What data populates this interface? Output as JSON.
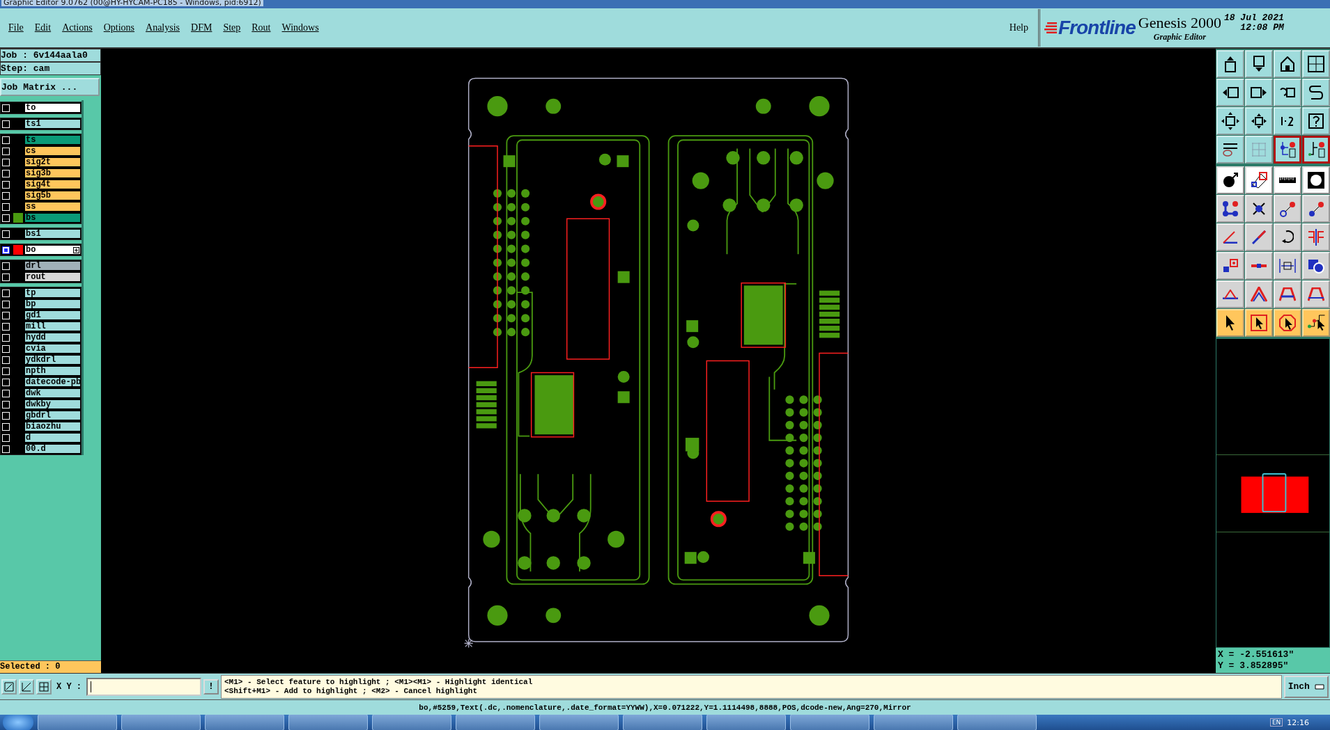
{
  "window": {
    "title": "Graphic Editor 9.0762 (00@HY-HYCAM-PC185 - Windows, pid:6912)"
  },
  "menu": [
    "File",
    "Edit",
    "Actions",
    "Options",
    "Analysis",
    "DFM",
    "Step",
    "Rout",
    "Windows"
  ],
  "help": "Help",
  "brand": {
    "logo": "Frontline",
    "product": "Genesis 2000",
    "subtitle": "Graphic Editor",
    "date": "18 Jul 2021",
    "time": "12:08 PM"
  },
  "job": {
    "job": "Job : 6v144aala0",
    "step": "Step: cam",
    "matrix_button": "Job Matrix ..."
  },
  "layer_groups": [
    {
      "layers": [
        {
          "name": "to",
          "color": "#ffffff",
          "selected": false
        }
      ]
    },
    {
      "layers": [
        {
          "name": "ts1",
          "color": "#9fdcdc",
          "selected": false
        }
      ]
    },
    {
      "layers": [
        {
          "name": "ts",
          "color": "#0a9a78",
          "selected": false
        },
        {
          "name": "cs",
          "color": "#ffc65c",
          "selected": false
        },
        {
          "name": "sig2t",
          "color": "#ffc65c",
          "selected": false
        },
        {
          "name": "sig3b",
          "color": "#ffc65c",
          "selected": false
        },
        {
          "name": "sig4t",
          "color": "#ffc65c",
          "selected": false
        },
        {
          "name": "sig5b",
          "color": "#ffc65c",
          "selected": false
        },
        {
          "name": "ss",
          "color": "#ffc65c",
          "selected": false
        },
        {
          "name": "bs",
          "color": "#0a9a78",
          "swatch": {
            "color": "#4a9a10"
          },
          "selected": false
        }
      ]
    },
    {
      "layers": [
        {
          "name": "bs1",
          "color": "#9fdcdc",
          "selected": false
        }
      ]
    },
    {
      "layers": [
        {
          "name": "bo",
          "color": "#ffffff",
          "swatch": {
            "color": "#ff0000"
          },
          "selected": true
        }
      ]
    },
    {
      "layers": [
        {
          "name": "drl",
          "color": "#a0b0b8",
          "selected": false
        },
        {
          "name": "rout",
          "color": "#d8d8d8",
          "selected": false
        }
      ]
    },
    {
      "layers": [
        {
          "name": "tp",
          "color": "#9fdcdc",
          "selected": false
        },
        {
          "name": "bp",
          "color": "#9fdcdc",
          "selected": false
        },
        {
          "name": "gd1",
          "color": "#9fdcdc",
          "selected": false
        },
        {
          "name": "mill",
          "color": "#9fdcdc",
          "selected": false
        },
        {
          "name": "hydd",
          "color": "#9fdcdc",
          "selected": false
        },
        {
          "name": "cvia",
          "color": "#9fdcdc",
          "selected": false
        },
        {
          "name": "ydkdrl",
          "color": "#9fdcdc",
          "selected": false
        },
        {
          "name": "npth",
          "color": "#9fdcdc",
          "selected": false
        },
        {
          "name": "datecode-pb",
          "color": "#9fdcdc",
          "selected": false
        },
        {
          "name": "dwk",
          "color": "#9fdcdc",
          "selected": false
        },
        {
          "name": "dwkby",
          "color": "#9fdcdc",
          "selected": false
        },
        {
          "name": "gbdrl",
          "color": "#9fdcdc",
          "selected": false
        },
        {
          "name": "biaozhu",
          "color": "#9fdcdc",
          "selected": false
        },
        {
          "name": "d",
          "color": "#9fdcdc",
          "selected": false
        },
        {
          "name": "00.d",
          "color": "#9fdcdc",
          "selected": false
        }
      ]
    }
  ],
  "selected_count": "Selected : 0",
  "tool_groups": [
    {
      "kind": "view",
      "buttons": [
        {
          "on": false
        },
        {
          "on": false
        },
        {
          "on": false
        },
        {
          "on": false
        },
        {
          "on": false
        },
        {
          "on": false
        },
        {
          "on": false
        },
        {
          "on": false
        },
        {
          "on": false
        },
        {
          "on": false
        },
        {
          "on": false
        },
        {
          "on": false
        },
        {
          "on": false
        },
        {
          "on": false
        },
        {
          "on": true
        },
        {
          "on": true
        }
      ]
    },
    {
      "kind": "edit",
      "buttons": [
        {
          "on": false
        },
        {
          "on": false
        },
        {
          "on": false
        },
        {
          "on": false
        },
        {
          "on": false
        },
        {
          "on": false
        },
        {
          "on": false
        },
        {
          "on": false
        },
        {
          "on": false
        },
        {
          "on": false
        },
        {
          "on": false
        },
        {
          "on": false
        },
        {
          "on": false
        },
        {
          "on": false
        },
        {
          "on": false
        },
        {
          "on": false
        },
        {
          "on": false
        },
        {
          "on": false
        },
        {
          "on": false
        },
        {
          "on": false
        },
        {
          "on": false
        },
        {
          "on": false
        },
        {
          "on": false
        },
        {
          "on": false
        }
      ]
    }
  ],
  "coordinates": {
    "x": "X = -2.551613\"",
    "y": "Y = 3.852895\""
  },
  "command_bar": {
    "xy_label": "X Y :",
    "bang": "!",
    "hints": [
      "<M1> - Select feature to highlight ; <M1><M1> - Highlight identical",
      "<Shift+M1> - Add to highlight ; <M2> - Cancel highlight"
    ],
    "units": "Inch"
  },
  "status_line": "bo,#5259,Text(.dc,.nomenclature,.date_format=YYWW),X=0.071222,Y=1.1114498,8888,POS,dcode-new,Ang=270,Mirror",
  "taskbar": {
    "language": "EN",
    "clock": "12:16"
  }
}
